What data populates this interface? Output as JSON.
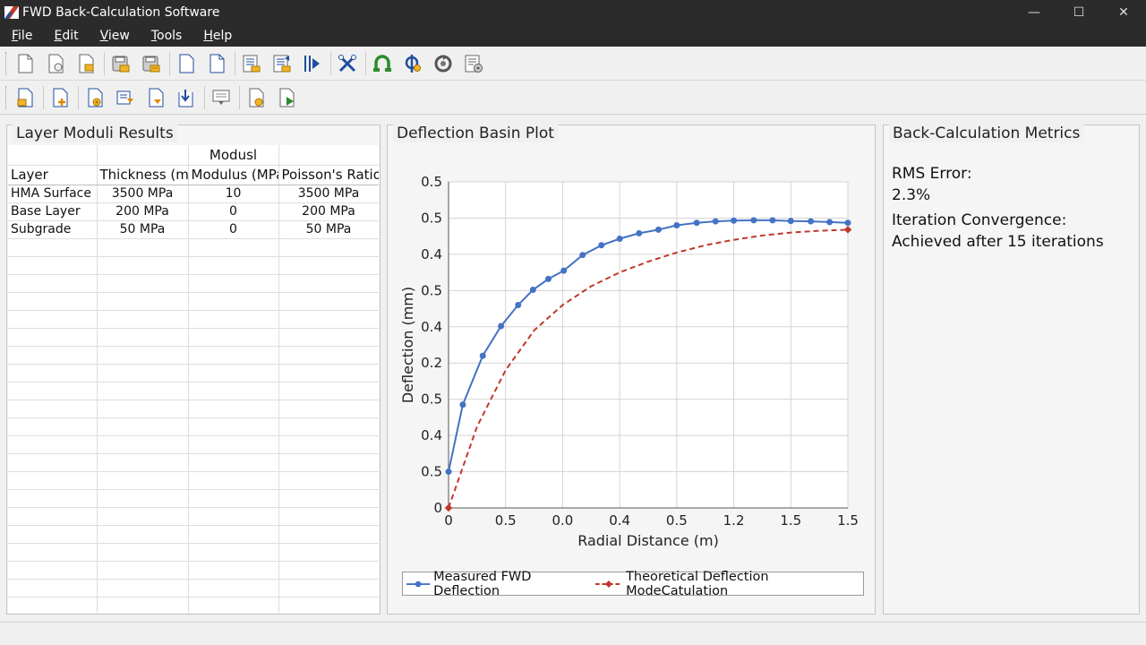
{
  "window": {
    "title": "FWD Back-Calculation Software",
    "minimize": "—",
    "maximize": "☐",
    "close": "✕"
  },
  "menu": [
    {
      "key": "F",
      "rest": "ile"
    },
    {
      "key": "E",
      "rest": "dit"
    },
    {
      "key": "V",
      "rest": "iew"
    },
    {
      "key": "T",
      "rest": "ools"
    },
    {
      "key": "H",
      "rest": "elp"
    }
  ],
  "toolbar1": [
    "new-document-icon",
    "open-document-icon",
    "open-folder-document-icon",
    "save-icon",
    "save-all-icon",
    "blank-page-icon",
    "page-icon",
    "import-data-icon",
    "export-data-icon",
    "run-analysis-icon",
    "tools-icon",
    "layer-model-icon",
    "probe-icon",
    "recalculate-icon",
    "report-settings-icon"
  ],
  "toolbar2": [
    "folder-document-icon",
    "add-document-icon",
    "document-settings-icon",
    "import-arrow-icon",
    "document-down-icon",
    "document-export-icon",
    "comment-icon",
    "document-gear-icon",
    "document-play-icon"
  ],
  "layer_panel": {
    "title": "Layer Moduli Results",
    "group_header": "Modusl",
    "columns": [
      "Layer",
      "Thickness (mm)",
      "Modulus (MPa)",
      "Poisson's Ratio"
    ],
    "rows": [
      [
        "HMA Surface",
        "3500 MPa",
        "10",
        "3500 MPa"
      ],
      [
        "Base Layer",
        "200 MPa",
        "0",
        "200 MPa"
      ],
      [
        "Subgrade",
        "50 MPa",
        "0",
        "50 MPa"
      ]
    ]
  },
  "plot_panel": {
    "title": "Deflection Basin Plot"
  },
  "metrics_panel": {
    "title": "Back-Calculation Metrics",
    "rms_label": "RMS Error:",
    "rms_value": "2.3%",
    "convergence_label": "Iteration Convergence:",
    "convergence_value": "Achieved after 15 iterations"
  },
  "colors": {
    "measured": "#4472c4",
    "theoretical": "#c0392b",
    "titlebar": "#2b2b2b"
  },
  "chart_data": {
    "type": "line",
    "xlabel": "Radial Distance (m)",
    "ylabel": "Deflection (mm)",
    "x_tick_labels": [
      "0",
      "0.5",
      "0.0",
      "0.4",
      "0.5",
      "1.2",
      "1.5",
      "1.5"
    ],
    "y_tick_labels": [
      "0",
      "0.5",
      "0.4",
      "0.5",
      "0.2",
      "0.4",
      "0.5",
      "0.4",
      "0.5",
      "0.5"
    ],
    "x_range": [
      0,
      7
    ],
    "y_range": [
      0,
      9
    ],
    "grid": true,
    "legend_position": "bottom",
    "series": [
      {
        "name": "Measured FWD Deflection",
        "style": "solid-markers",
        "x": [
          0,
          0.25,
          0.6,
          0.92,
          1.22,
          1.48,
          1.75,
          2.02,
          2.35,
          2.68,
          3.0,
          3.34,
          3.68,
          4.0,
          4.35,
          4.68,
          5.0,
          5.35,
          5.68,
          6.0,
          6.35,
          6.68,
          7.0
        ],
        "y": [
          1.0,
          2.85,
          4.2,
          5.02,
          5.6,
          6.02,
          6.32,
          6.55,
          6.98,
          7.25,
          7.43,
          7.58,
          7.68,
          7.8,
          7.87,
          7.91,
          7.93,
          7.94,
          7.94,
          7.92,
          7.91,
          7.89,
          7.87
        ]
      },
      {
        "name": "Theoretical Deflection ModeCatulation",
        "style": "dashed",
        "x": [
          0,
          0.5,
          1.0,
          1.5,
          2.0,
          2.5,
          3.0,
          3.5,
          4.0,
          4.5,
          5.0,
          5.5,
          6.0,
          6.5,
          7.0
        ],
        "y": [
          0,
          2.25,
          3.8,
          4.9,
          5.6,
          6.12,
          6.5,
          6.8,
          7.05,
          7.25,
          7.4,
          7.52,
          7.6,
          7.65,
          7.68
        ]
      }
    ]
  }
}
